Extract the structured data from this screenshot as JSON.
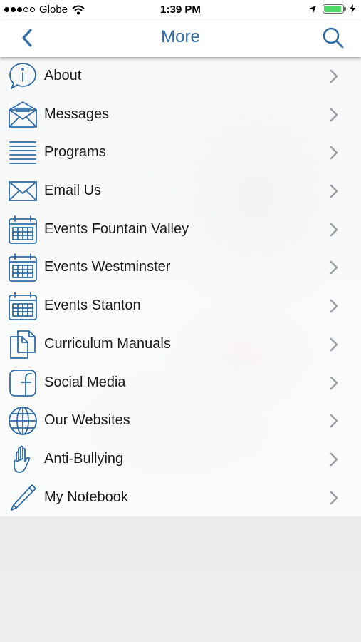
{
  "status_bar": {
    "carrier": "Globe",
    "time": "1:39 PM",
    "battery_color": "#4cd964"
  },
  "nav": {
    "title": "More",
    "back_icon": "chevron-left-icon",
    "search_icon": "search-icon"
  },
  "accent_color": "#2e6ca8",
  "menu": {
    "items": [
      {
        "label": "About",
        "icon": "info-bubble-icon"
      },
      {
        "label": "Messages",
        "icon": "envelope-open-icon"
      },
      {
        "label": "Programs",
        "icon": "list-lines-icon"
      },
      {
        "label": "Email Us",
        "icon": "envelope-icon"
      },
      {
        "label": "Events Fountain Valley",
        "icon": "calendar-icon"
      },
      {
        "label": "Events Westminster",
        "icon": "calendar-icon"
      },
      {
        "label": "Events Stanton",
        "icon": "calendar-icon"
      },
      {
        "label": "Curriculum Manuals",
        "icon": "documents-icon"
      },
      {
        "label": "Social Media",
        "icon": "facebook-icon"
      },
      {
        "label": "Our Websites",
        "icon": "globe-icon"
      },
      {
        "label": "Anti-Bullying",
        "icon": "hand-icon"
      },
      {
        "label": "My Notebook",
        "icon": "pencil-icon"
      }
    ]
  }
}
